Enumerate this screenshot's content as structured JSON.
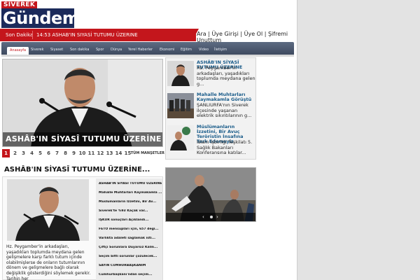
{
  "logo": {
    "top": "SIVEREK",
    "main": "Gündemi"
  },
  "ticker": {
    "label": "Son Dakika",
    "text": "14:53 ASHAB'IN SIYASİ TUTUMU ÜZERINE"
  },
  "userlinks": {
    "text": "Ara | Üye Girişi | Üye Ol | Şifremi Unuttum"
  },
  "nav": {
    "items": [
      "Anasayfa",
      "Siverek",
      "Siyaset",
      "Son dakika",
      "Spor",
      "Dünya",
      "Yerel Haberler",
      "Ekonomi",
      "Eğitim",
      "Video",
      "İletişim"
    ]
  },
  "feature": {
    "caption": "ASHÂB'IN SİYASÎ TUTUMU ÜZERİNE"
  },
  "pager": {
    "pages": [
      "1",
      "2",
      "3",
      "4",
      "5",
      "6",
      "7",
      "8",
      "9",
      "10",
      "11",
      "12",
      "13",
      "14",
      "15"
    ],
    "more": "TÜM MANŞETLER"
  },
  "side_news": [
    {
      "title": "ASHÂB'IN SİYASÎ TUTUMU ÜZERİNE",
      "desc": "Hz. Peygamber'in arkadaşları, yaşadıkları toplumda meydana gelen g..."
    },
    {
      "title": "Mahalle Muhtarları Kaymakamla Görüştü",
      "desc": "ŞANLIURFA'nın Siverek ilçesinde  yaşanan elektrik sıkıntılarının g..."
    },
    {
      "title": "Müslümanların İzzetini, Bir Avuç Teröristin İnsafına Terk Edemeyiz",
      "desc": "İslam İşbirliği Teşkilatı 5. Sağlık Bakanları Konferansına katılar..."
    }
  ],
  "article": {
    "heading": "ASHÂB'IN SİYASÎ TUTUMU ÜZERİNE...",
    "text": "Hz. Peygamber'in arkadaşları, yaşadıkları toplumda meydana gelen gelişmelere karşı farklı tutum içinde olabilmişlerse de onların tutumlarının dönem ve gelişmelere bağlı olarak değişiklik gösterdiğini söylemek gerekir. Tarihin her",
    "links": [
      "ASHÂB'IN SİYASÎ TUTUMU ÜZERİNE...",
      "Mahalle Muhtarları Kaymakamla ...",
      "Müslümanların İzzetini, Bir Av...",
      "Siverek'te %93 Kaçak var...",
      "İŞKUR sonuçları Açıklandı...",
      "FETÖ mensupları için, 657 deği...",
      "Varlıkta adaleti sağlamak isti...",
      "Çiftçi Sorunlara Duyarsız Kalm...",
      "Seçim bitti sorunlar çözülecek...",
      "SAYIN CUMHURBAŞKANIM",
      "Cumhurbaşkanı'ndan seçim..."
    ]
  },
  "photo": {
    "prev": "‹",
    "next": "›"
  }
}
